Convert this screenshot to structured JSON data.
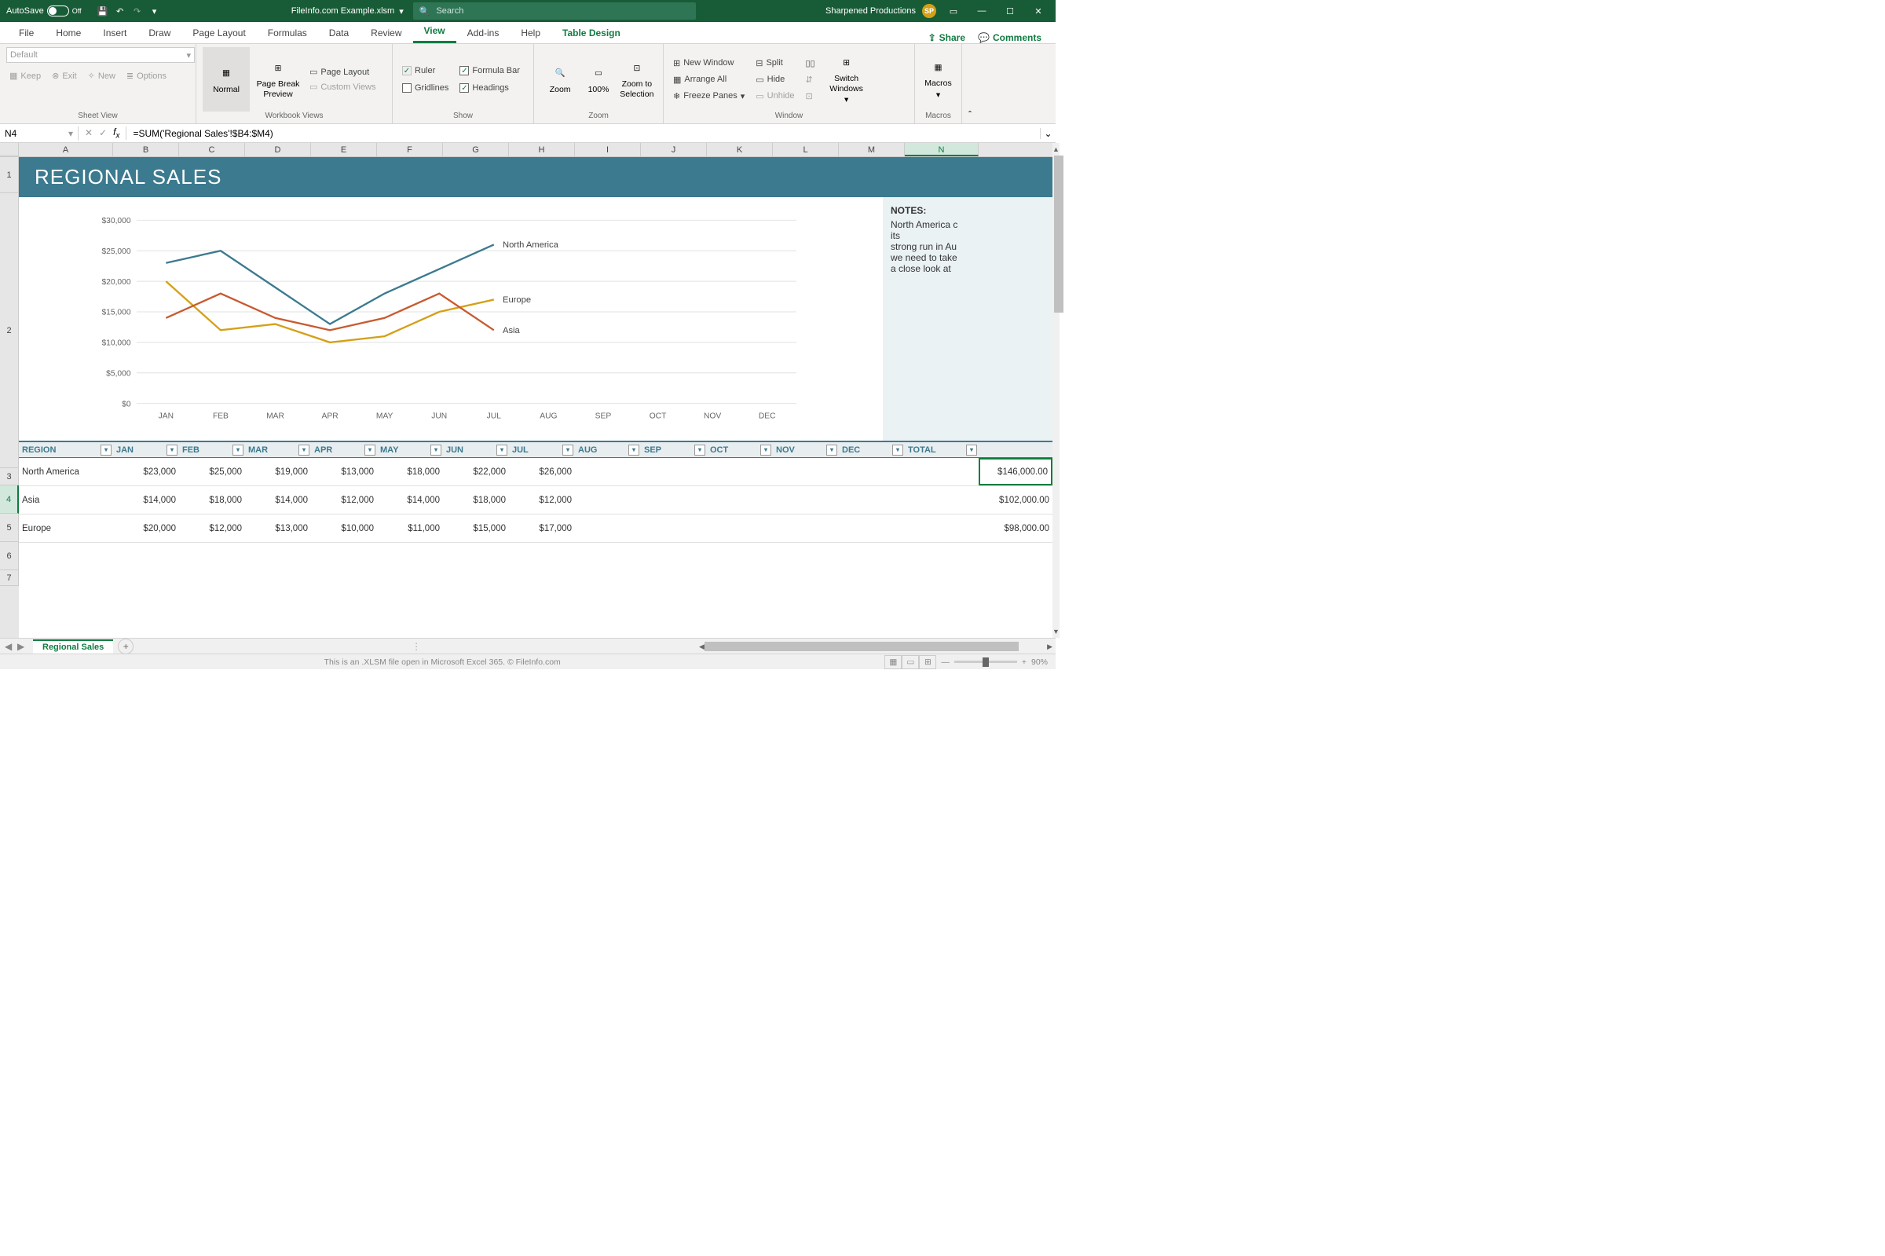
{
  "titlebar": {
    "autosave_label": "AutoSave",
    "autosave_state": "Off",
    "filename": "FileInfo.com Example.xlsm",
    "search_placeholder": "Search",
    "username": "Sharpened Productions",
    "user_initials": "SP"
  },
  "ribbon_tabs": [
    "File",
    "Home",
    "Insert",
    "Draw",
    "Page Layout",
    "Formulas",
    "Data",
    "Review",
    "View",
    "Add-ins",
    "Help",
    "Table Design"
  ],
  "active_tab": "View",
  "share_label": "Share",
  "comments_label": "Comments",
  "ribbon": {
    "sheetview": {
      "default": "Default",
      "keep": "Keep",
      "exit": "Exit",
      "new": "New",
      "options": "Options",
      "title": "Sheet View"
    },
    "workbook_views": {
      "normal": "Normal",
      "pagebreak": "Page Break Preview",
      "pagelayout": "Page Layout",
      "custom": "Custom Views",
      "title": "Workbook Views"
    },
    "show": {
      "ruler": "Ruler",
      "gridlines": "Gridlines",
      "formula_bar": "Formula Bar",
      "headings": "Headings",
      "title": "Show"
    },
    "zoom": {
      "zoom": "Zoom",
      "hundred": "100%",
      "selection": "Zoom to Selection",
      "title": "Zoom"
    },
    "window": {
      "new_window": "New Window",
      "arrange": "Arrange All",
      "freeze": "Freeze Panes",
      "split": "Split",
      "hide": "Hide",
      "unhide": "Unhide",
      "switch": "Switch Windows",
      "title": "Window"
    },
    "macros": {
      "label": "Macros",
      "title": "Macros"
    }
  },
  "formula_bar": {
    "namebox": "N4",
    "formula": "=SUM('Regional Sales'!$B4:$M4)"
  },
  "columns": [
    "A",
    "B",
    "C",
    "D",
    "E",
    "F",
    "G",
    "H",
    "I",
    "J",
    "K",
    "L",
    "M",
    "N"
  ],
  "sheet": {
    "title": "REGIONAL SALES",
    "notes_title": "NOTES:",
    "notes_lines": [
      "North America c",
      "its",
      "strong run in Au",
      "we need to take",
      "a close look at"
    ],
    "table": {
      "headers": [
        "REGION",
        "JAN",
        "FEB",
        "MAR",
        "APR",
        "MAY",
        "JUN",
        "JUL",
        "AUG",
        "SEP",
        "OCT",
        "NOV",
        "DEC",
        "TOTAL"
      ],
      "rows": [
        {
          "region": "North America",
          "vals": [
            "$23,000",
            "$25,000",
            "$19,000",
            "$13,000",
            "$18,000",
            "$22,000",
            "$26,000",
            "",
            "",
            "",
            "",
            "",
            ""
          ],
          "total": "$146,000.00"
        },
        {
          "region": "Asia",
          "vals": [
            "$14,000",
            "$18,000",
            "$14,000",
            "$12,000",
            "$14,000",
            "$18,000",
            "$12,000",
            "",
            "",
            "",
            "",
            "",
            ""
          ],
          "total": "$102,000.00"
        },
        {
          "region": "Europe",
          "vals": [
            "$20,000",
            "$12,000",
            "$13,000",
            "$10,000",
            "$11,000",
            "$15,000",
            "$17,000",
            "",
            "",
            "",
            "",
            "",
            ""
          ],
          "total": "$98,000.00"
        }
      ]
    }
  },
  "chart_data": {
    "type": "line",
    "title": "REGIONAL SALES",
    "categories": [
      "JAN",
      "FEB",
      "MAR",
      "APR",
      "MAY",
      "JUN",
      "JUL",
      "AUG",
      "SEP",
      "OCT",
      "NOV",
      "DEC"
    ],
    "ylabel": "",
    "xlabel": "",
    "ylim": [
      0,
      30000
    ],
    "yticks": [
      "$0",
      "$5,000",
      "$10,000",
      "$15,000",
      "$20,000",
      "$25,000",
      "$30,000"
    ],
    "series": [
      {
        "name": "North America",
        "color": "#3b7a8f",
        "values": [
          23000,
          25000,
          19000,
          13000,
          18000,
          22000,
          26000
        ]
      },
      {
        "name": "Europe",
        "color": "#d4a017",
        "values": [
          20000,
          12000,
          13000,
          10000,
          11000,
          15000,
          17000
        ]
      },
      {
        "name": "Asia",
        "color": "#c85a2f",
        "values": [
          14000,
          18000,
          14000,
          12000,
          14000,
          18000,
          12000
        ]
      }
    ]
  },
  "sheet_tabs": {
    "active": "Regional Sales"
  },
  "statusbar": {
    "message": "This is an .XLSM file open in Microsoft Excel 365. © FileInfo.com",
    "zoom": "90%"
  },
  "col_widths": {
    "row": 24,
    "A": 120,
    "default": 84,
    "N": 94
  }
}
